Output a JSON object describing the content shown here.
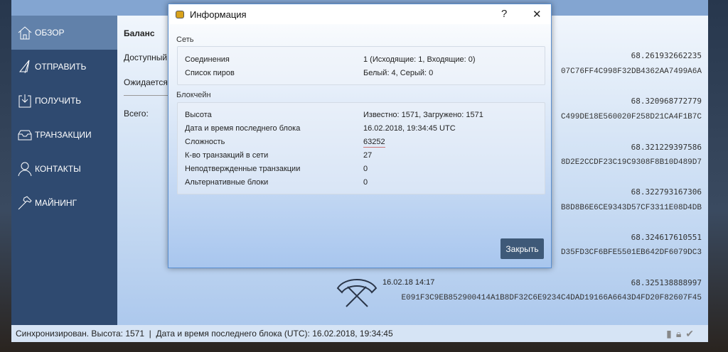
{
  "sidebar": {
    "items": [
      {
        "label": "ОБЗОР"
      },
      {
        "label": "ОТПРАВИТЬ"
      },
      {
        "label": "ПОЛУЧИТЬ"
      },
      {
        "label": "ТРАНЗАКЦИИ"
      },
      {
        "label": "КОНТАКТЫ"
      },
      {
        "label": "МАЙНИНГ"
      }
    ]
  },
  "balance": {
    "title": "Баланс",
    "available": "Доступный",
    "pending": "Ожидается:",
    "total": "Всего:"
  },
  "transactions": [
    {
      "amount": "68.261932662235",
      "hash": "07C76FF4C998F32DB4362AA7499A6A"
    },
    {
      "amount": "68.320968772779",
      "hash": "C499DE18E560020F258D21CA4F1B7C"
    },
    {
      "amount": "68.321229397586",
      "hash": "8D2E2CCDF23C19C9308F8B10D489D7"
    },
    {
      "amount": "68.322793167306",
      "hash": "B8D8B6E6CE9343D57CF3311E08D4DB"
    },
    {
      "amount": "68.324617610551",
      "hash": "D35FD3CF6BFE5501EB642DF6079DC3"
    },
    {
      "amount": "68.325138888997",
      "date": "16.02.18 14:17",
      "hash": "E091F3C9EB852900414A1B8DF32C6E9234C4DAD19166A6643D4FD20F82607F45"
    }
  ],
  "status": {
    "text": "Синхронизирован. Высота: 1571  |  Дата и время последнего блока (UTC): 16.02.2018, 19:34:45"
  },
  "dialog": {
    "title": "Информация",
    "help": "?",
    "close_x": "✕",
    "network": {
      "title": "Сеть",
      "rows": [
        {
          "label": "Соединения",
          "value": "1 (Исходящие: 1, Входящие: 0)"
        },
        {
          "label": "Список пиров",
          "value": "Белый: 4, Серый: 0"
        }
      ]
    },
    "blockchain": {
      "title": "Блокчейн",
      "rows": [
        {
          "label": "Высота",
          "value": "Известно: 1571, Загружено: 1571"
        },
        {
          "label": "Дата и время последнего блока",
          "value": "16.02.2018, 19:34:45 UTC"
        },
        {
          "label": "Сложность",
          "value": "63252"
        },
        {
          "label": "К-во транзакций в сети",
          "value": "27"
        },
        {
          "label": "Неподтвержденные транзакции",
          "value": "0"
        },
        {
          "label": "Альтернативные блоки",
          "value": "0"
        }
      ]
    },
    "close_button": "Закрыть"
  }
}
